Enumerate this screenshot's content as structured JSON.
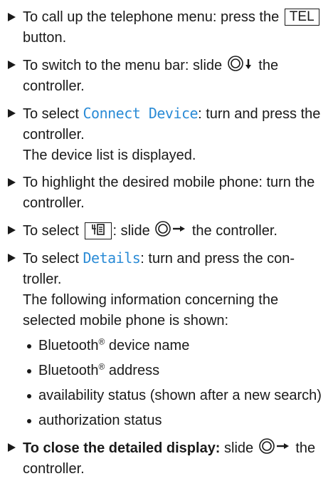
{
  "steps": [
    {
      "pre": "To call up the telephone menu: press the",
      "key": "TEL",
      "post": "button."
    },
    {
      "pre": "To switch to the menu bar: slide",
      "post": "the controller."
    },
    {
      "pre": "To select",
      "menu": "Connect Device",
      "post": ": turn and press the controller.",
      "result": "The device list is displayed."
    },
    {
      "text": "To highlight the desired mobile phone: turn the controller."
    },
    {
      "pre": "To select",
      "mid": ": slide",
      "post": "the controller."
    },
    {
      "pre": "To select",
      "menu": "Details",
      "post": ": turn and press the con-troller.",
      "result": "The following information concerning the selected mobile phone is shown:"
    },
    {
      "bold": "To close the detailed display:",
      "mid": "slide",
      "post": "the controller."
    }
  ],
  "details_list": [
    {
      "text": "Bluetooth",
      "sup": "®",
      "tail": "device name"
    },
    {
      "text": "Bluetooth",
      "sup": "®",
      "tail": "address"
    },
    {
      "text": "availability status (shown after a new search)"
    },
    {
      "text": "authorization status"
    }
  ],
  "icons": {
    "controller": "controller-icon",
    "arrow_down": "arrow-down-icon",
    "arrow_right": "arrow-right-icon",
    "phone_menu": "phone-menu-icon"
  }
}
